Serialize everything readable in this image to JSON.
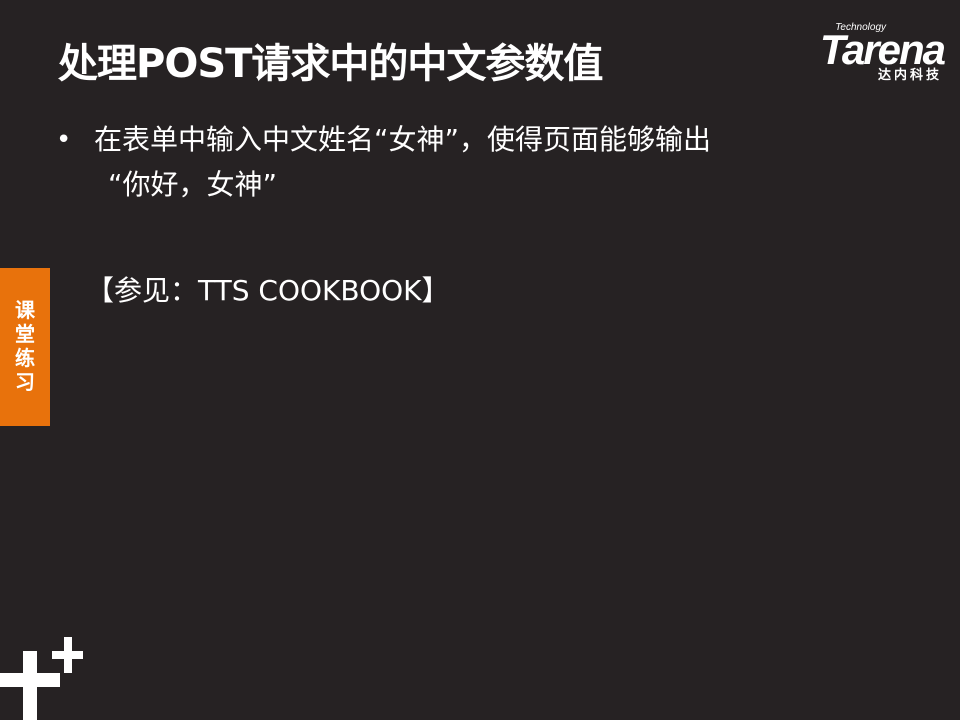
{
  "slide": {
    "title": "处理POST请求中的中文参数值",
    "bullet": {
      "line1": "在表单中输入中文姓名“女神”，使得页面能够输出",
      "line2": "“你好，女神”"
    },
    "reference": "【参见：TTS COOKBOOK】"
  },
  "logo": {
    "tagline": "Technology",
    "wordmark": "Tarena",
    "subtitle": "达内科技"
  },
  "side_tab": {
    "label": "课堂练习"
  },
  "icons": {
    "bullet": "bullet-dot-icon",
    "decoration": "plus-decoration-icon"
  },
  "colors": {
    "background": "#262223",
    "accent": "#e8720c",
    "text": "#ffffff"
  }
}
